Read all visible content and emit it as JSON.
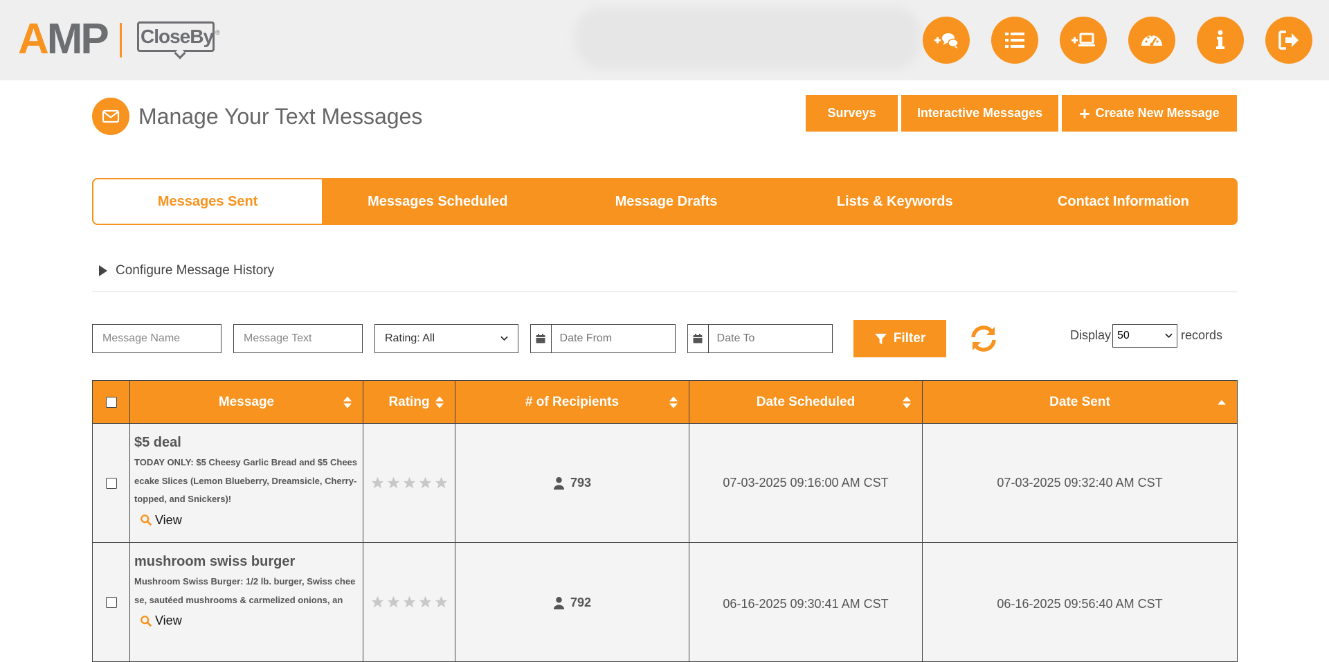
{
  "header": {
    "logo_amp_a": "A",
    "logo_amp_mp": "MP",
    "logo_closeby": "CloseBy",
    "logo_closeby_tm": "®",
    "nav_icons": [
      "add-conversation-icon",
      "list-icon",
      "add-device-icon",
      "dashboard-icon",
      "info-icon",
      "logout-icon"
    ]
  },
  "page": {
    "title": "Manage Your Text Messages",
    "buttons": {
      "surveys": "Surveys",
      "interactive": "Interactive Messages",
      "create": "Create New Message"
    }
  },
  "tabs": [
    {
      "label": "Messages Sent",
      "active": true
    },
    {
      "label": "Messages Scheduled",
      "active": false
    },
    {
      "label": "Message Drafts",
      "active": false
    },
    {
      "label": "Lists & Keywords",
      "active": false
    },
    {
      "label": "Contact Information",
      "active": false
    }
  ],
  "configure": {
    "label": "Configure Message History"
  },
  "filters": {
    "message_name_placeholder": "Message Name",
    "message_text_placeholder": "Message Text",
    "rating_selected": "Rating: All",
    "date_from_placeholder": "Date From",
    "date_to_placeholder": "Date To",
    "filter_label": "Filter",
    "display_label": "Display",
    "display_value": "50",
    "records_label": "records"
  },
  "table": {
    "columns": [
      "Message",
      "Rating",
      "# of Recipients",
      "Date Scheduled",
      "Date Sent"
    ],
    "rows": [
      {
        "name": "$5 deal",
        "text": "TODAY ONLY: $5 Cheesy Garlic Bread and $5 Cheesecake Slices (Lemon Blueberry, Dreamsicle, Cherry-topped, and Snickers)!",
        "view_label": "View",
        "rating": 0,
        "recipients": "793",
        "date_scheduled": "07-03-2025 09:16:00 AM CST",
        "date_sent": "07-03-2025 09:32:40 AM CST"
      },
      {
        "name": "mushroom swiss burger",
        "text": "Mushroom Swiss Burger: 1/2 lb. burger, Swiss cheese, sautéed mushrooms & carmelized onions, an",
        "view_label": "View",
        "rating": 0,
        "recipients": "792",
        "date_scheduled": "06-16-2025 09:30:41 AM CST",
        "date_sent": "06-16-2025 09:56:40 AM CST"
      }
    ]
  },
  "colors": {
    "accent": "#f7931e",
    "header_bg": "#efefef",
    "row_bg": "#f4f4f4",
    "text": "#555555"
  }
}
